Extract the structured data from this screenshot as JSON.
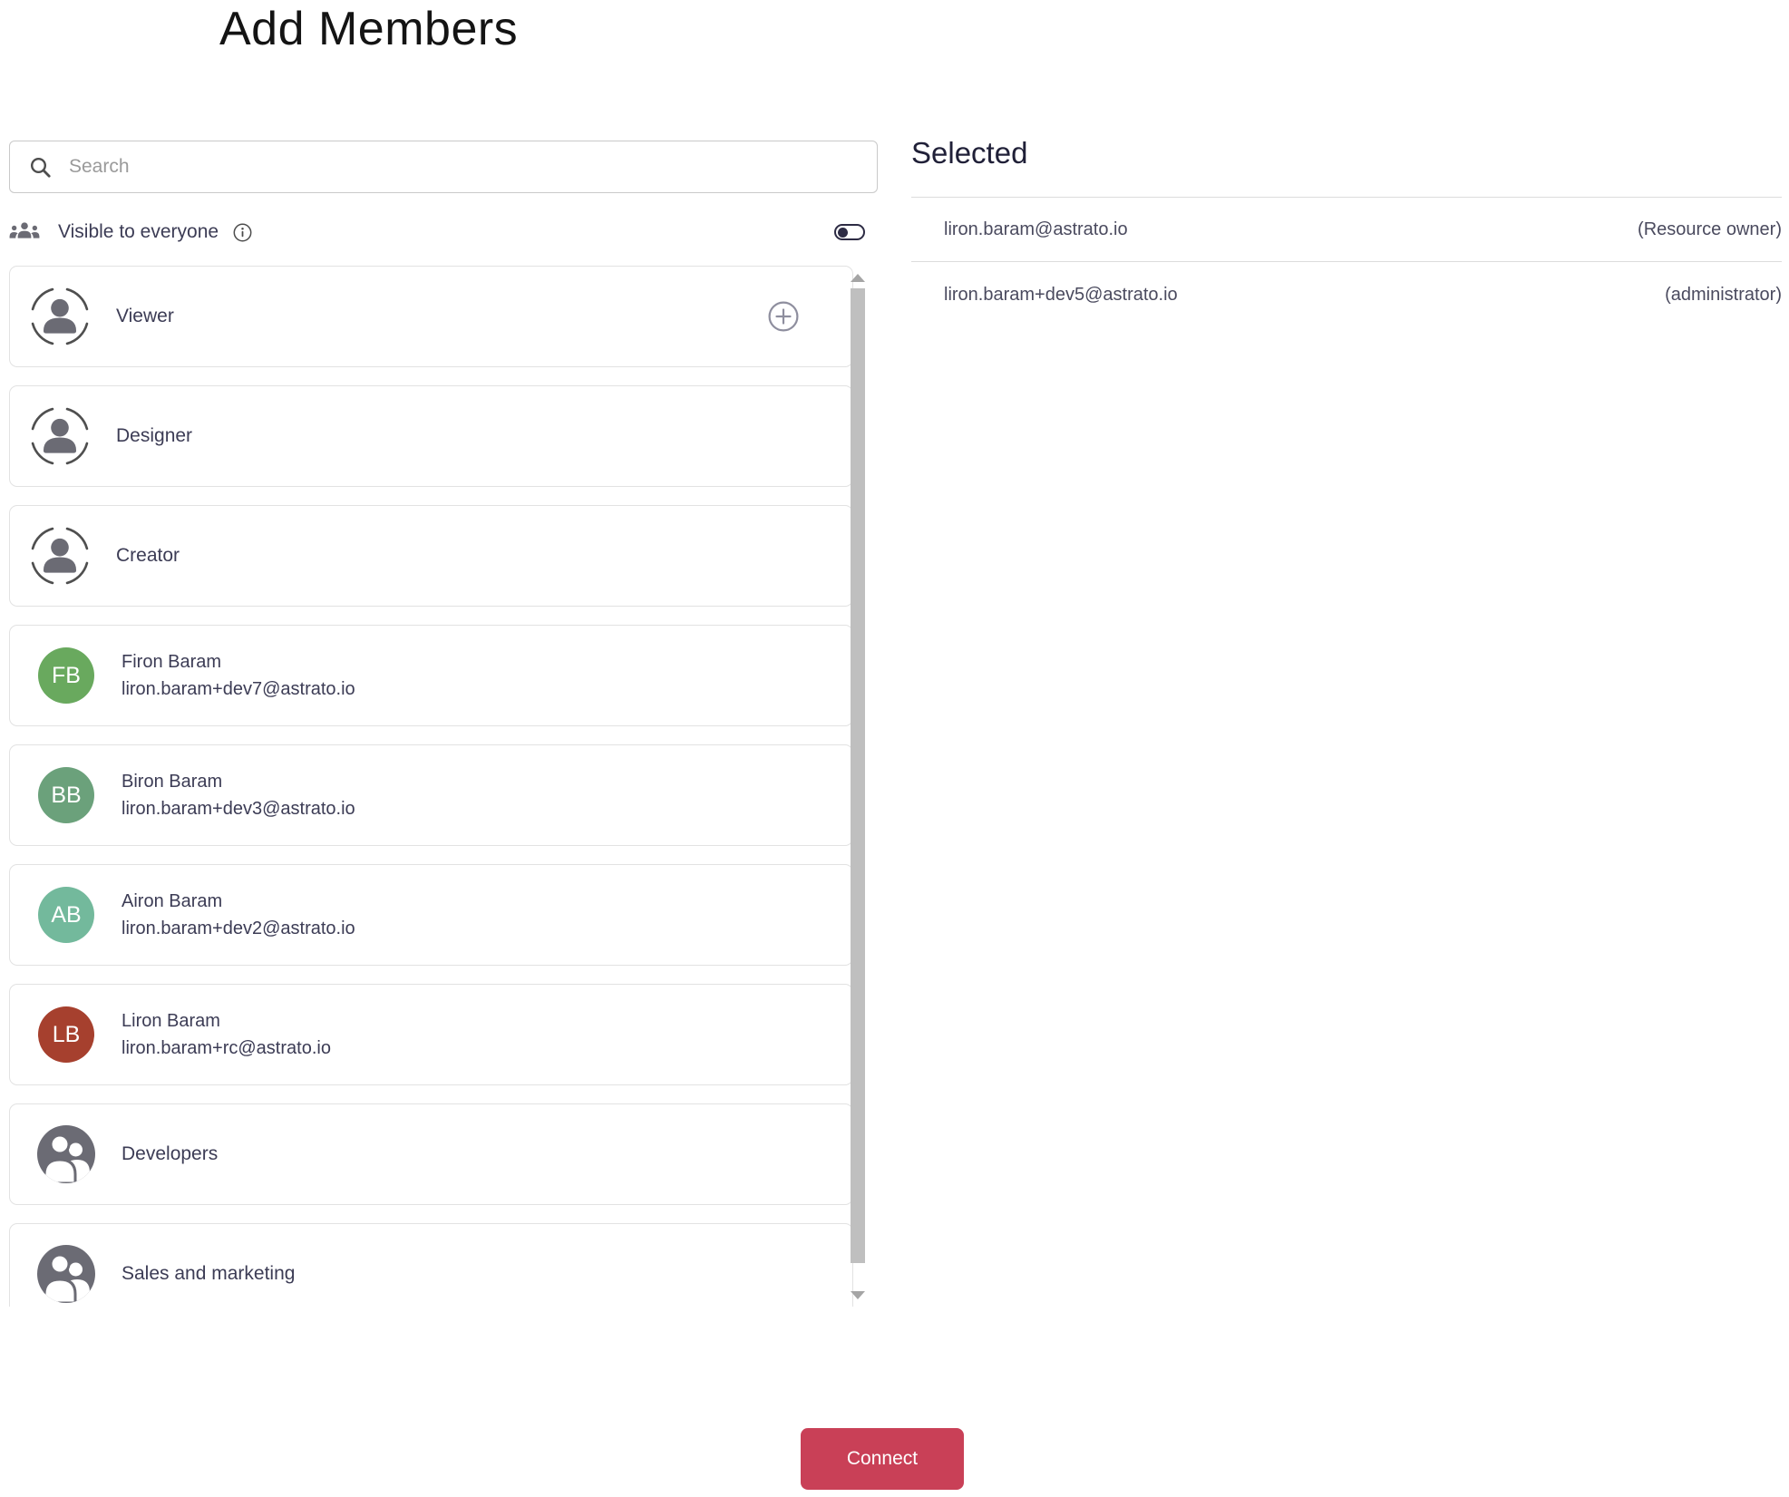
{
  "page": {
    "title": "Add Members"
  },
  "search": {
    "placeholder": "Search",
    "value": ""
  },
  "visibility": {
    "label": "Visible to everyone",
    "toggle_state": "off"
  },
  "list": {
    "items": [
      {
        "type": "role",
        "label": "Viewer",
        "has_add_button": true
      },
      {
        "type": "role",
        "label": "Designer"
      },
      {
        "type": "role",
        "label": "Creator"
      },
      {
        "type": "user",
        "initials": "FB",
        "name": "Firon Baram",
        "email": "liron.baram+dev7@astrato.io",
        "avatar_color": "#69a95e"
      },
      {
        "type": "user",
        "initials": "BB",
        "name": "Biron Baram",
        "email": "liron.baram+dev3@astrato.io",
        "avatar_color": "#6ba17b"
      },
      {
        "type": "user",
        "initials": "AB",
        "name": "Airon Baram",
        "email": "liron.baram+dev2@astrato.io",
        "avatar_color": "#73b99c"
      },
      {
        "type": "user",
        "initials": "LB",
        "name": "Liron Baram",
        "email": "liron.baram+rc@astrato.io",
        "avatar_color": "#a6402e"
      },
      {
        "type": "group",
        "label": "Developers"
      },
      {
        "type": "group",
        "label": "Sales and marketing"
      }
    ]
  },
  "selected": {
    "heading": "Selected",
    "members": [
      {
        "email": "liron.baram@astrato.io",
        "role": "(Resource owner)"
      },
      {
        "email": "liron.baram+dev5@astrato.io",
        "role": "(administrator)"
      }
    ]
  },
  "footer": {
    "connect_label": "Connect"
  },
  "colors": {
    "accent": "#c94057",
    "icon_gray": "#6b6b74",
    "text_navy": "#3c3c55"
  }
}
